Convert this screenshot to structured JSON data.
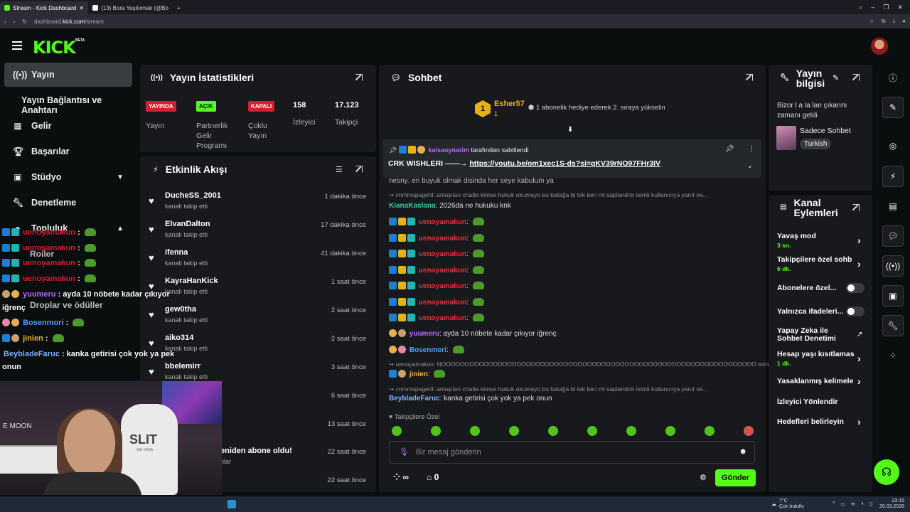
{
  "browser": {
    "tabs": [
      {
        "label": "Stream - Kick Dashboard",
        "active": true
      },
      {
        "label": "(13) Bora Yeşilırmak (@Bo",
        "active": false
      }
    ],
    "url_prefix": "dashboard.",
    "url_domain": "kick.com",
    "url_path": "/stream"
  },
  "brand": {
    "logo": "KICK",
    "beta": "BETA",
    "accent": "#53fc18"
  },
  "nav": {
    "yayin": "Yayın",
    "yayin_baglantisi": "Yayın Bağlantısı ve Anahtarı",
    "gelir": "Gelir",
    "basarilar": "Başarılar",
    "studyo": "Stüdyo",
    "denetleme": "Denetleme",
    "topluluk": "Topluluk",
    "roller": "Roller",
    "droplar": "Droplar ve ödüller"
  },
  "stats": {
    "title": "Yayın İstatistikleri",
    "items": [
      {
        "badge": "YAYINDA",
        "label": "Yayın"
      },
      {
        "badge": "AÇIK",
        "label": "Partnerlik Gelir Programı"
      },
      {
        "badge": "KAPALI",
        "label": "Çoklu Yayın"
      },
      {
        "value": "158",
        "label": "İzleyici"
      },
      {
        "value": "17.123",
        "label": "Takipçi"
      }
    ]
  },
  "activity": {
    "title": "Etkinlik Akışı",
    "items": [
      {
        "name": "DucheSS_2001",
        "sub": "kanalı takip etti",
        "time": "1 dakika önce"
      },
      {
        "name": "ElvanDalton",
        "sub": "kanalı takip etti",
        "time": "17 dakika önce"
      },
      {
        "name": "ifenna",
        "sub": "kanalı takip etti",
        "time": "41 dakika önce"
      },
      {
        "name": "KayraHanKick",
        "sub": "kanalı takip etti",
        "time": "1 saat önce"
      },
      {
        "name": "gew0tha",
        "sub": "kanalı takip etti",
        "time": "2 saat önce"
      },
      {
        "name": "aiko314",
        "sub": "kanalı takip etti",
        "time": "2 saat önce"
      },
      {
        "name": "bbelemirr",
        "sub": "kanalı takip etti",
        "time": "3 saat önce"
      },
      {
        "name": "",
        "sub": "",
        "time": "6 saat önce"
      },
      {
        "name": "",
        "sub": "",
        "time": "13 saat önce"
      },
      {
        "name": "eniden abone oldu!",
        "sub": "olar",
        "time": "22 saat önce"
      },
      {
        "name": "",
        "sub": "",
        "time": "22 saat önce"
      }
    ]
  },
  "chat": {
    "title": "Sohbet",
    "top_gifter": {
      "rank": "1",
      "name": "Esher57",
      "count": "1"
    },
    "gift_text": "1 abonelik hediye ederek 2. sıraya yükselin",
    "pinned_by": "kaisaoynarim",
    "pinned_suffix": "tarafından sabitlendi",
    "pinned_text": "CRK WISHLERI ——→",
    "pinned_link": "https://youtu.be/om1xec1S-ds?si=qKV39rNO97FHr3IV",
    "partial_line": "nesny: en buyuk olmak disinda her seye kabulum ya",
    "reply1": "cnmmspagettl: anlaşılan chatte kimse hukuk okumuyo bu batağa bi tek ben mi saplandım isimli kullanıcıya yanıt ve...",
    "kiana_user": "KianaKaslana",
    "kiana_msg": "2026da ne hukuku knk",
    "spam_user": "uenoyamakun",
    "yuumeru_user": "yuumeru",
    "yuumeru_msg": "ayda 10 nöbete kadar çıkıyor iğrenç",
    "bosenmori_user": "Bosenmori",
    "reply2": "uenoyamakun: NOOOOOOOOOOOOOOOOOOOOOOOOOOOOOOOOOOOOOOOOOOOOOOOOOOOOOOOOOOOOOOOOOOO isimli kul...",
    "jinien_user": "jinien",
    "reply3": "cnmmspagettl: anlaşılan chatte kimse hukuk okumuyo bu batağa bi tek ben mi saplandım isimli kullanıcıya yanıt ve...",
    "beyblade_user": "BeybladeFaruc",
    "beyblade_msg": "kanka getirisi çok yok ya pek onun",
    "followers_only": "Takipçilere Özel",
    "input_placeholder": "Bir mesaj gönderin",
    "points_label": "∞",
    "store_count": "0",
    "send_label": "Gönder"
  },
  "stream_info": {
    "title": "Yayın bilgisi",
    "stream_title_partial": "Bizor l a la lan çıkarını zamanı geldi",
    "category": "Sadece Sohbet",
    "tag": "Turkish"
  },
  "channel_actions": {
    "title": "Kanal Eylemleri",
    "items": [
      {
        "label": "Yavaş mod",
        "sub": "3 sn.",
        "type": "chevron"
      },
      {
        "label": "Takipçilere özel sohb",
        "sub": "6 dk.",
        "type": "chevron"
      },
      {
        "label": "Abonelere özel...",
        "sub": "",
        "type": "toggle"
      },
      {
        "label": "Yalnızca ifadeleri...",
        "sub": "",
        "type": "toggle"
      },
      {
        "label": "Yapay Zeka ile Sohbet Denetimi",
        "sub": "",
        "type": "external"
      },
      {
        "label": "Hesap yaşı kısıtlamas",
        "sub": "1 dk.",
        "type": "chevron"
      },
      {
        "label": "Yasaklanmış kelimele",
        "sub": "",
        "type": "chevron"
      },
      {
        "label": "İzleyici Yönlendir",
        "sub": "",
        "type": "none"
      },
      {
        "label": "Hedefleri belirleyin",
        "sub": "",
        "type": "chevron"
      }
    ]
  },
  "overlay_chat": [
    {
      "user": "uenoyamakun",
      "msg": ":",
      "color": "#d1202f"
    },
    {
      "user": "uenoyamakun",
      "msg": ":",
      "color": "#d1202f"
    },
    {
      "user": "uenoyamakun",
      "msg": ":",
      "color": "#d1202f"
    },
    {
      "user": "uenoyamakun",
      "msg": ":",
      "color": "#d1202f"
    },
    {
      "user": "yuumeru",
      "msg": ": ayda 10 nöbete kadar çıkıyor",
      "color": "#b96bff"
    },
    {
      "user": "",
      "msg": "iğrenç",
      "color": "#ffffff"
    },
    {
      "user": "Bosenmori",
      "msg": ":",
      "color": "#4aa3ff"
    },
    {
      "user": "jinien",
      "msg": ":",
      "color": "#f2b431"
    },
    {
      "user": "BeybladeFaruc",
      "msg": ": kanka getirisi çok yok ya pek",
      "color": "#7fb2ff"
    },
    {
      "user": "",
      "msg": "onun",
      "color": "#ffffff"
    }
  ],
  "webcam": {
    "sign": "SLIT",
    "sign2": "SIK YEGA",
    "moon": "E MOON"
  },
  "taskbar": {
    "weather": "7°C",
    "weather_sub": "Çok bulutlu",
    "time": "23:15",
    "date": "26.03.2026"
  },
  "colors": {
    "live_red": "#d1202f",
    "username_red": "#e0323f",
    "username_teal": "#3ec6a6",
    "username_purple": "#b96bff",
    "username_blue": "#4aa3ff",
    "username_orange": "#f2b431",
    "username_lightblue": "#7fb2ff"
  }
}
